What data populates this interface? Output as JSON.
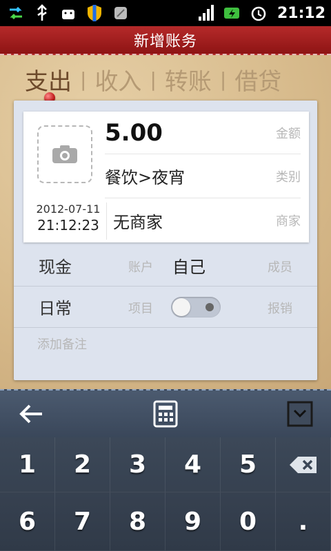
{
  "status_bar": {
    "time": "21:12",
    "left_icons": [
      "usb-sync-icon",
      "usb-icon",
      "android-debug-icon",
      "shield-icon",
      "note-icon"
    ],
    "right_icons": [
      "signal-icon",
      "battery-charging-icon",
      "alarm-icon"
    ]
  },
  "header": {
    "title": "新增账务"
  },
  "tabs": [
    {
      "label": "支出",
      "active": true
    },
    {
      "label": "收入",
      "active": false
    },
    {
      "label": "转账",
      "active": false
    },
    {
      "label": "借贷",
      "active": false
    }
  ],
  "entry": {
    "amount": "5.00",
    "amount_label": "金额",
    "category": "餐饮>夜宵",
    "category_label": "类别",
    "date": "2012-07-11",
    "time": "21:12:23",
    "merchant": "无商家",
    "merchant_label": "商家"
  },
  "account_row": {
    "value": "现金",
    "label": "账户",
    "member_value": "自己",
    "member_label": "成员"
  },
  "project_row": {
    "value": "日常",
    "label": "项目",
    "reimburse_label": "报销",
    "reimburse_enabled": false
  },
  "note": {
    "placeholder": "添加备注"
  },
  "keyboard": {
    "toolbar_icons": [
      "back-arrow-icon",
      "calculator-icon",
      "collapse-icon"
    ],
    "keys": [
      "1",
      "2",
      "3",
      "4",
      "5",
      "⌫",
      "6",
      "7",
      "8",
      "9",
      "0",
      "."
    ]
  },
  "colors": {
    "title_bar": "#9f1f1f",
    "panel": "#dde3ee",
    "keyboard": "#2f3a48"
  }
}
